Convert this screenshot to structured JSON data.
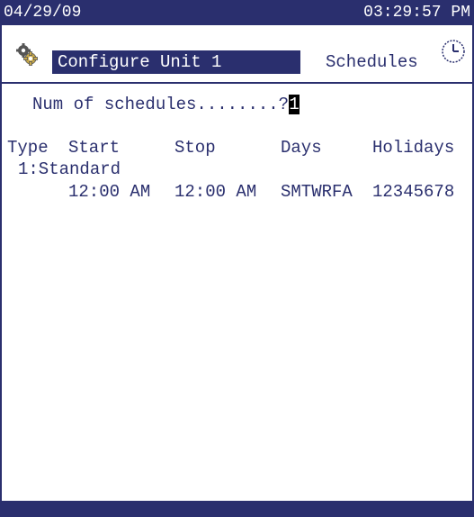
{
  "status_bar": {
    "date": "04/29/09",
    "time": "03:29:57 PM"
  },
  "header": {
    "title": "Configure Unit 1",
    "section": "Schedules",
    "left_icon": "gears-icon",
    "right_icon": "clock-icon"
  },
  "form": {
    "num_label": "Num of schedules........?",
    "num_value": "1"
  },
  "table": {
    "columns": [
      "Type",
      "Start",
      "Stop",
      "Days",
      "Holidays"
    ],
    "rows": [
      {
        "label": "1:Standard",
        "start": "12:00 AM",
        "stop": "12:00 AM",
        "days": "SMTWRFA",
        "holidays": "12345678"
      }
    ]
  },
  "colors": {
    "accent": "#2a2f6e",
    "background": "#ffffff"
  }
}
